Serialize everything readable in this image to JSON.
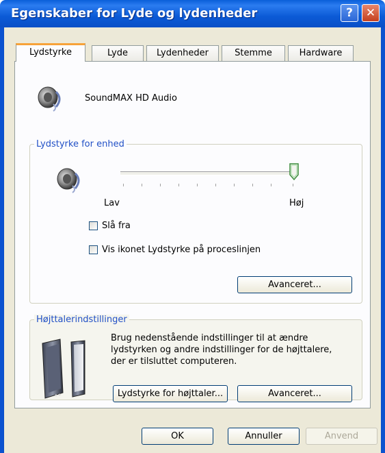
{
  "window": {
    "title": "Egenskaber for Lyde og lydenheder",
    "help_label": "?",
    "close_label": "✕"
  },
  "tabs": [
    {
      "label": "Lydstyrke",
      "active": true
    },
    {
      "label": "Lyde",
      "active": false
    },
    {
      "label": "Lydenheder",
      "active": false
    },
    {
      "label": "Stemme",
      "active": false
    },
    {
      "label": "Hardware",
      "active": false
    }
  ],
  "device": {
    "name": "SoundMAX HD Audio",
    "icon": "speaker-icon"
  },
  "volume_group": {
    "title": "Lydstyrke for enhed",
    "slider": {
      "low_label": "Lav",
      "high_label": "Høj",
      "value": 1.0
    },
    "mute_label": "Slå fra",
    "mute_checked": false,
    "tray_label": "Vis ikonet Lydstyrke på proceslinjen",
    "tray_checked": false,
    "advanced_label": "Avanceret..."
  },
  "speaker_group": {
    "title": "Højttalerindstillinger",
    "description_line1": "Brug nedenstående indstillinger til at ændre",
    "description_line2": "lydstyrken og andre indstillinger for de højttalere,",
    "description_line3": "der er tilsluttet computeren.",
    "speaker_volume_label": "Lydstyrke for højttaler...",
    "advanced_label": "Avanceret..."
  },
  "footer": {
    "ok_label": "OK",
    "cancel_label": "Annuller",
    "apply_label": "Anvend",
    "apply_enabled": false
  },
  "colors": {
    "titlebar": "#0a5fd9",
    "active_tab_accent": "#f7a238",
    "group_title": "#2150c6"
  }
}
